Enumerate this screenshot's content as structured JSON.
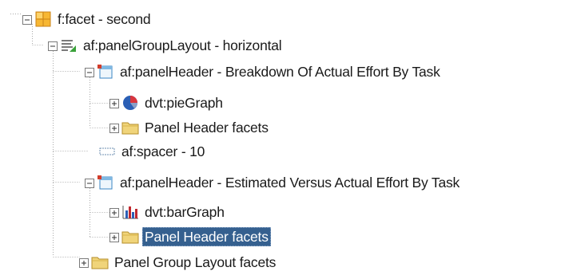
{
  "tree": {
    "nodes": [
      {
        "label": "f:facet - second",
        "icon": "facet-grid-icon",
        "expander": "collapse"
      },
      {
        "label": "af:panelGroupLayout - horizontal",
        "icon": "panel-group-layout-icon",
        "expander": "collapse"
      },
      {
        "label": "af:panelHeader - Breakdown Of Actual Effort By Task",
        "icon": "panel-header-icon",
        "expander": "collapse"
      },
      {
        "label": "dvt:pieGraph",
        "icon": "pie-graph-icon",
        "expander": "expand"
      },
      {
        "label": "Panel Header facets",
        "icon": "folder-icon",
        "expander": "expand"
      },
      {
        "label": "af:spacer - 10",
        "icon": "spacer-icon",
        "expander": "none"
      },
      {
        "label": "af:panelHeader - Estimated Versus Actual Effort By Task",
        "icon": "panel-header-icon",
        "expander": "collapse"
      },
      {
        "label": "dvt:barGraph",
        "icon": "bar-graph-icon",
        "expander": "expand"
      },
      {
        "label": "Panel Header facets",
        "icon": "folder-icon",
        "expander": "expand",
        "selected": true
      },
      {
        "label": "Panel Group Layout facets",
        "icon": "folder-icon",
        "expander": "expand"
      }
    ]
  },
  "colors": {
    "selection": "#35608f",
    "folder": "#f0d47a",
    "guide": "#a0a0a0"
  }
}
